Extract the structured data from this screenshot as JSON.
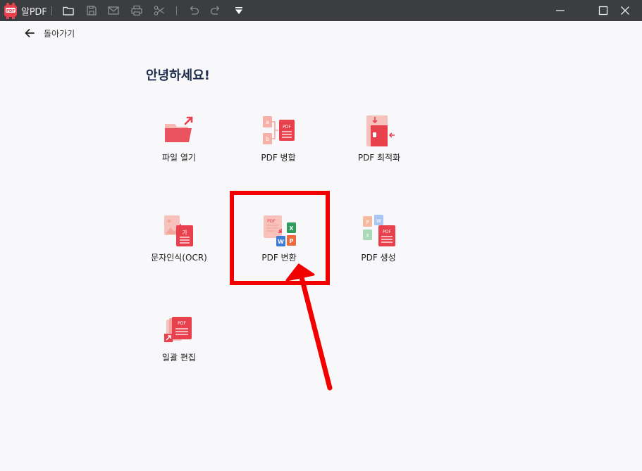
{
  "titlebar": {
    "app_title": "알PDF",
    "icons": [
      "folder-icon",
      "save-icon",
      "mail-icon",
      "print-icon",
      "scissors-icon",
      "undo-icon",
      "redo-icon",
      "dropdown-icon"
    ],
    "window_buttons": [
      "minimize-icon",
      "maximize-icon",
      "close-icon"
    ]
  },
  "back": {
    "label": "돌아가기"
  },
  "greeting": "안녕하세요!",
  "tiles": [
    {
      "label": "파일 열기",
      "icon": "open-file-icon"
    },
    {
      "label": "PDF 병합",
      "icon": "merge-pdf-icon"
    },
    {
      "label": "PDF 최적화",
      "icon": "optimize-pdf-icon"
    },
    {
      "label": "문자인식(OCR)",
      "icon": "ocr-icon"
    },
    {
      "label": "PDF 변환",
      "icon": "convert-pdf-icon"
    },
    {
      "label": "PDF 생성",
      "icon": "create-pdf-icon"
    },
    {
      "label": "일괄 편집",
      "icon": "batch-edit-icon"
    }
  ],
  "colors": {
    "titlebar": "#3b3d41",
    "background": "#f8f8fb",
    "accent_red": "#e8414d",
    "highlight": "#f20000"
  }
}
